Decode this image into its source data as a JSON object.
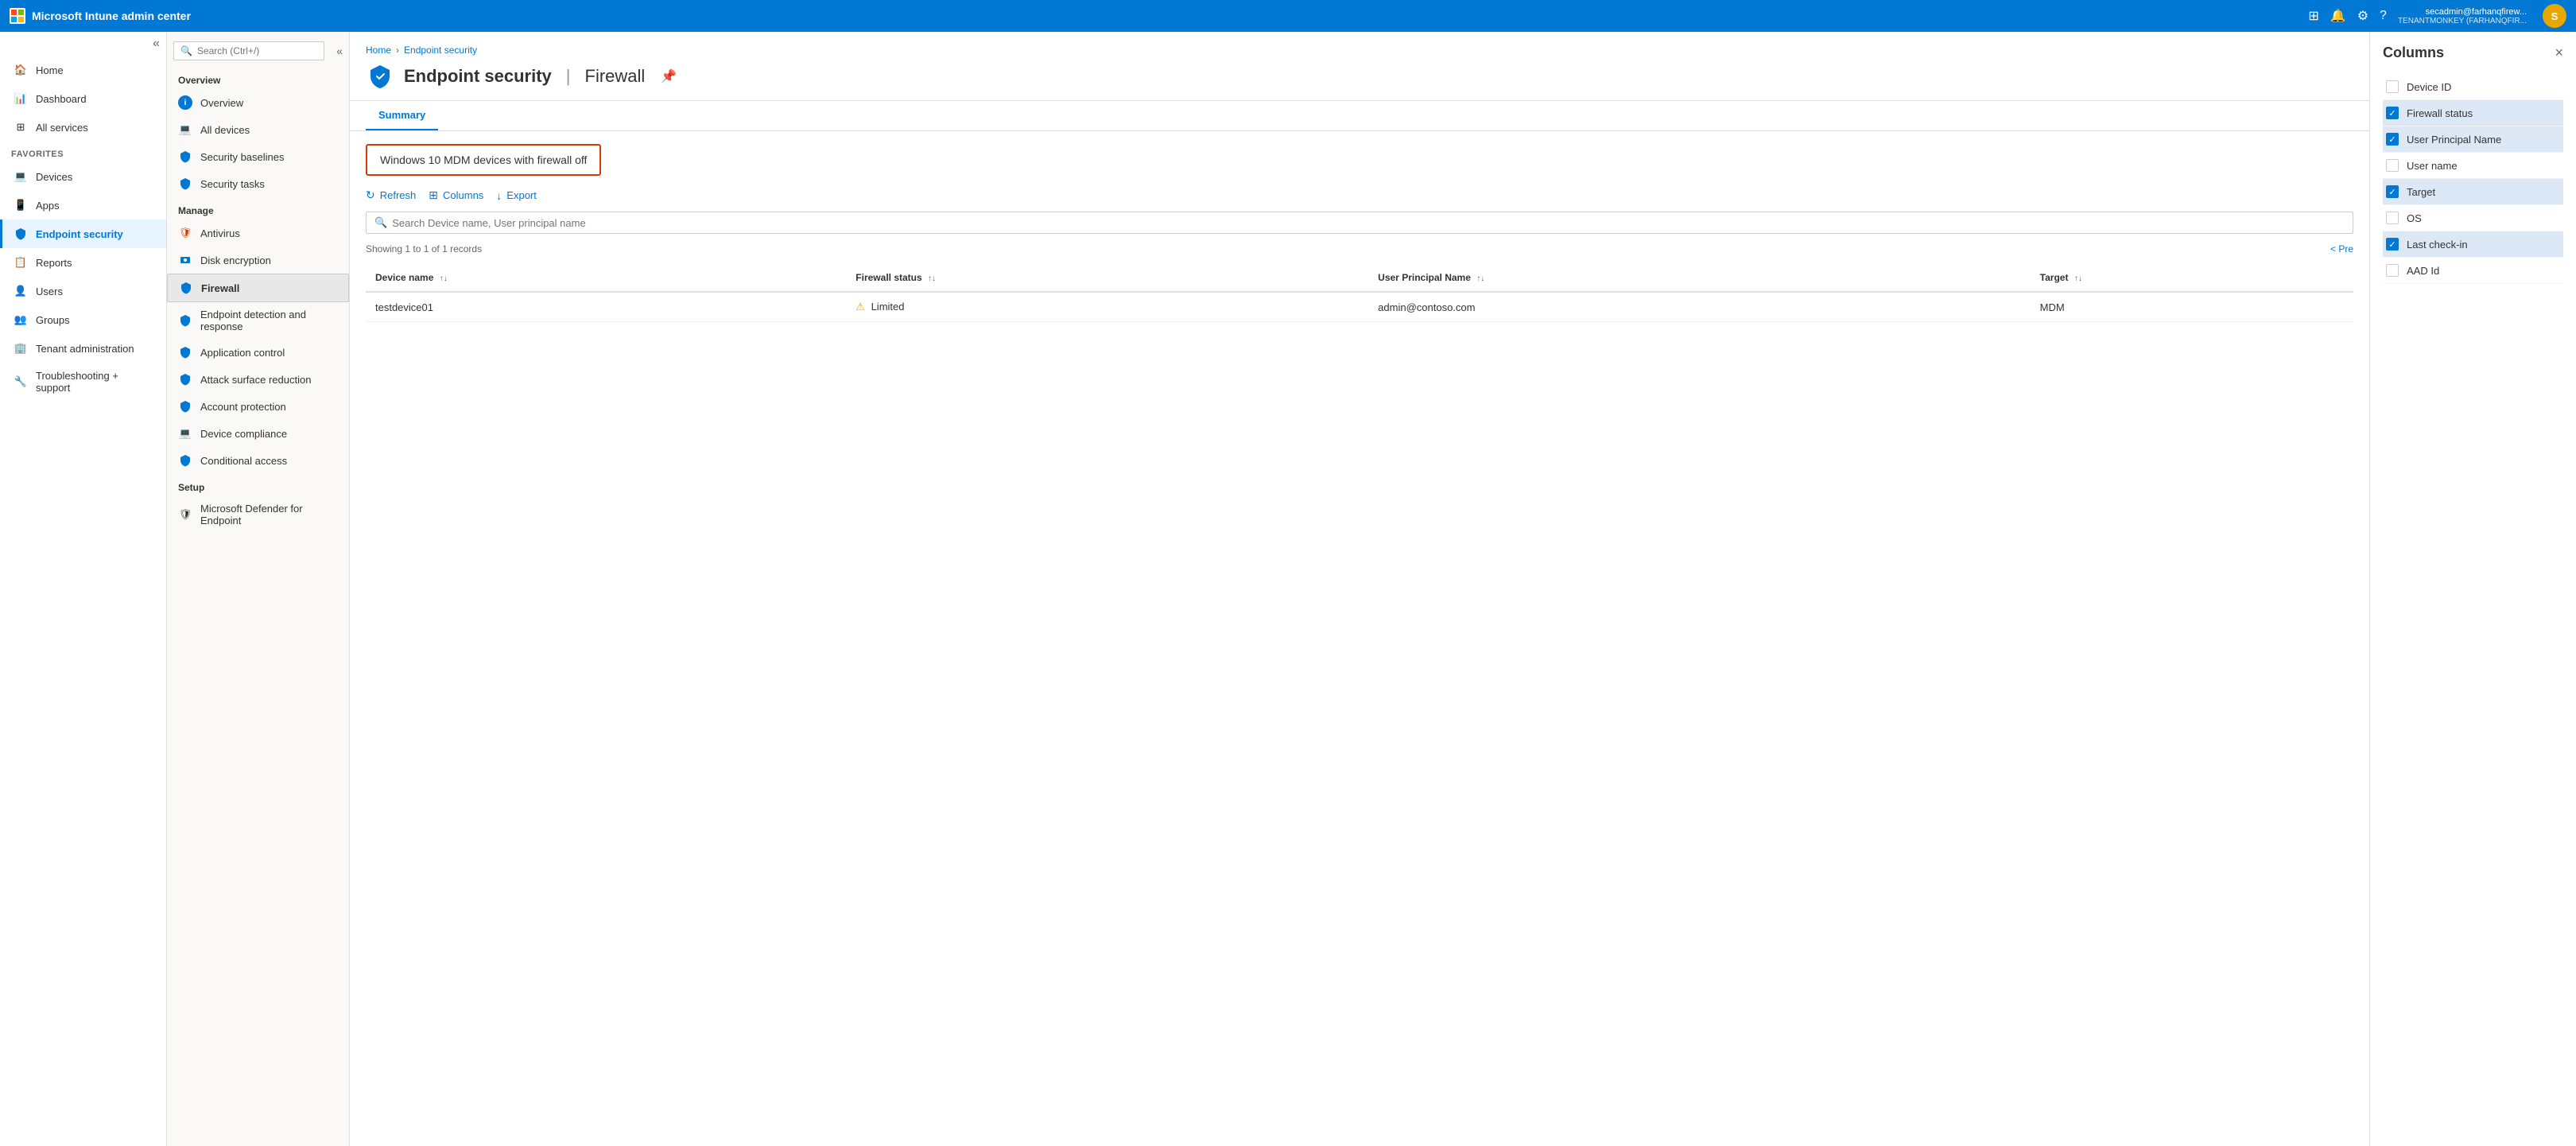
{
  "topbar": {
    "title": "Microsoft Intune admin center",
    "user_email": "secadmin@farhanqfirew...",
    "user_tenant": "TENANTMONKEY (FARHANQFIR...",
    "avatar_initials": "S"
  },
  "sidebar": {
    "items": [
      {
        "id": "home",
        "label": "Home",
        "icon": "home"
      },
      {
        "id": "dashboard",
        "label": "Dashboard",
        "icon": "dashboard"
      },
      {
        "id": "all-services",
        "label": "All services",
        "icon": "grid"
      },
      {
        "id": "favorites",
        "label": "FAVORITES",
        "type": "section"
      },
      {
        "id": "devices",
        "label": "Devices",
        "icon": "devices"
      },
      {
        "id": "apps",
        "label": "Apps",
        "icon": "apps"
      },
      {
        "id": "endpoint-security",
        "label": "Endpoint security",
        "icon": "shield",
        "active": true
      },
      {
        "id": "reports",
        "label": "Reports",
        "icon": "reports"
      },
      {
        "id": "users",
        "label": "Users",
        "icon": "users"
      },
      {
        "id": "groups",
        "label": "Groups",
        "icon": "groups"
      },
      {
        "id": "tenant-admin",
        "label": "Tenant administration",
        "icon": "tenant"
      },
      {
        "id": "troubleshooting",
        "label": "Troubleshooting + support",
        "icon": "wrench"
      }
    ]
  },
  "secondary_nav": {
    "search_placeholder": "Search (Ctrl+/)",
    "overview_section": "Overview",
    "overview_items": [
      {
        "id": "overview",
        "label": "Overview",
        "icon": "info"
      },
      {
        "id": "all-devices",
        "label": "All devices",
        "icon": "devices"
      },
      {
        "id": "security-baselines",
        "label": "Security baselines",
        "icon": "baseline"
      },
      {
        "id": "security-tasks",
        "label": "Security tasks",
        "icon": "task"
      }
    ],
    "manage_section": "Manage",
    "manage_items": [
      {
        "id": "antivirus",
        "label": "Antivirus",
        "icon": "antivirus"
      },
      {
        "id": "disk-encryption",
        "label": "Disk encryption",
        "icon": "disk"
      },
      {
        "id": "firewall",
        "label": "Firewall",
        "icon": "firewall",
        "active": true
      },
      {
        "id": "edr",
        "label": "Endpoint detection and response",
        "icon": "edr"
      },
      {
        "id": "app-control",
        "label": "Application control",
        "icon": "app-control"
      },
      {
        "id": "attack-surface",
        "label": "Attack surface reduction",
        "icon": "attack"
      },
      {
        "id": "account-protection",
        "label": "Account protection",
        "icon": "account"
      },
      {
        "id": "device-compliance",
        "label": "Device compliance",
        "icon": "compliance"
      },
      {
        "id": "conditional-access",
        "label": "Conditional access",
        "icon": "conditional"
      }
    ],
    "setup_section": "Setup",
    "setup_items": [
      {
        "id": "ms-defender",
        "label": "Microsoft Defender for Endpoint",
        "icon": "defender"
      }
    ]
  },
  "page": {
    "breadcrumb_home": "Home",
    "breadcrumb_section": "Endpoint security",
    "title": "Endpoint security",
    "subtitle": "Firewall",
    "tab_summary": "Summary",
    "tab_selected": "Windows 10 MDM devices with firewall off",
    "refresh_label": "Refresh",
    "columns_label": "Columns",
    "export_label": "Export",
    "search_placeholder": "Search Device name, User principal name",
    "records_text": "Showing 1 to 1 of 1 records",
    "pagination_prev": "< Pre",
    "table": {
      "columns": [
        {
          "id": "device-name",
          "label": "Device name",
          "sortable": true
        },
        {
          "id": "firewall-status",
          "label": "Firewall status",
          "sortable": true
        },
        {
          "id": "upn",
          "label": "User Principal Name",
          "sortable": true
        },
        {
          "id": "target",
          "label": "Target",
          "sortable": true
        }
      ],
      "rows": [
        {
          "device_name": "testdevice01",
          "firewall_status": "Limited",
          "firewall_status_warning": true,
          "upn": "admin@contoso.com",
          "target": "MDM"
        }
      ]
    }
  },
  "columns_panel": {
    "title": "Columns",
    "close_label": "×",
    "items": [
      {
        "id": "device-id",
        "label": "Device ID",
        "checked": false
      },
      {
        "id": "firewall-status",
        "label": "Firewall status",
        "checked": true
      },
      {
        "id": "upn",
        "label": "User Principal Name",
        "checked": true
      },
      {
        "id": "user-name",
        "label": "User name",
        "checked": false
      },
      {
        "id": "target",
        "label": "Target",
        "checked": true
      },
      {
        "id": "os",
        "label": "OS",
        "checked": false
      },
      {
        "id": "last-checkin",
        "label": "Last check-in",
        "checked": true
      },
      {
        "id": "aad-id",
        "label": "AAD Id",
        "checked": false
      }
    ]
  }
}
